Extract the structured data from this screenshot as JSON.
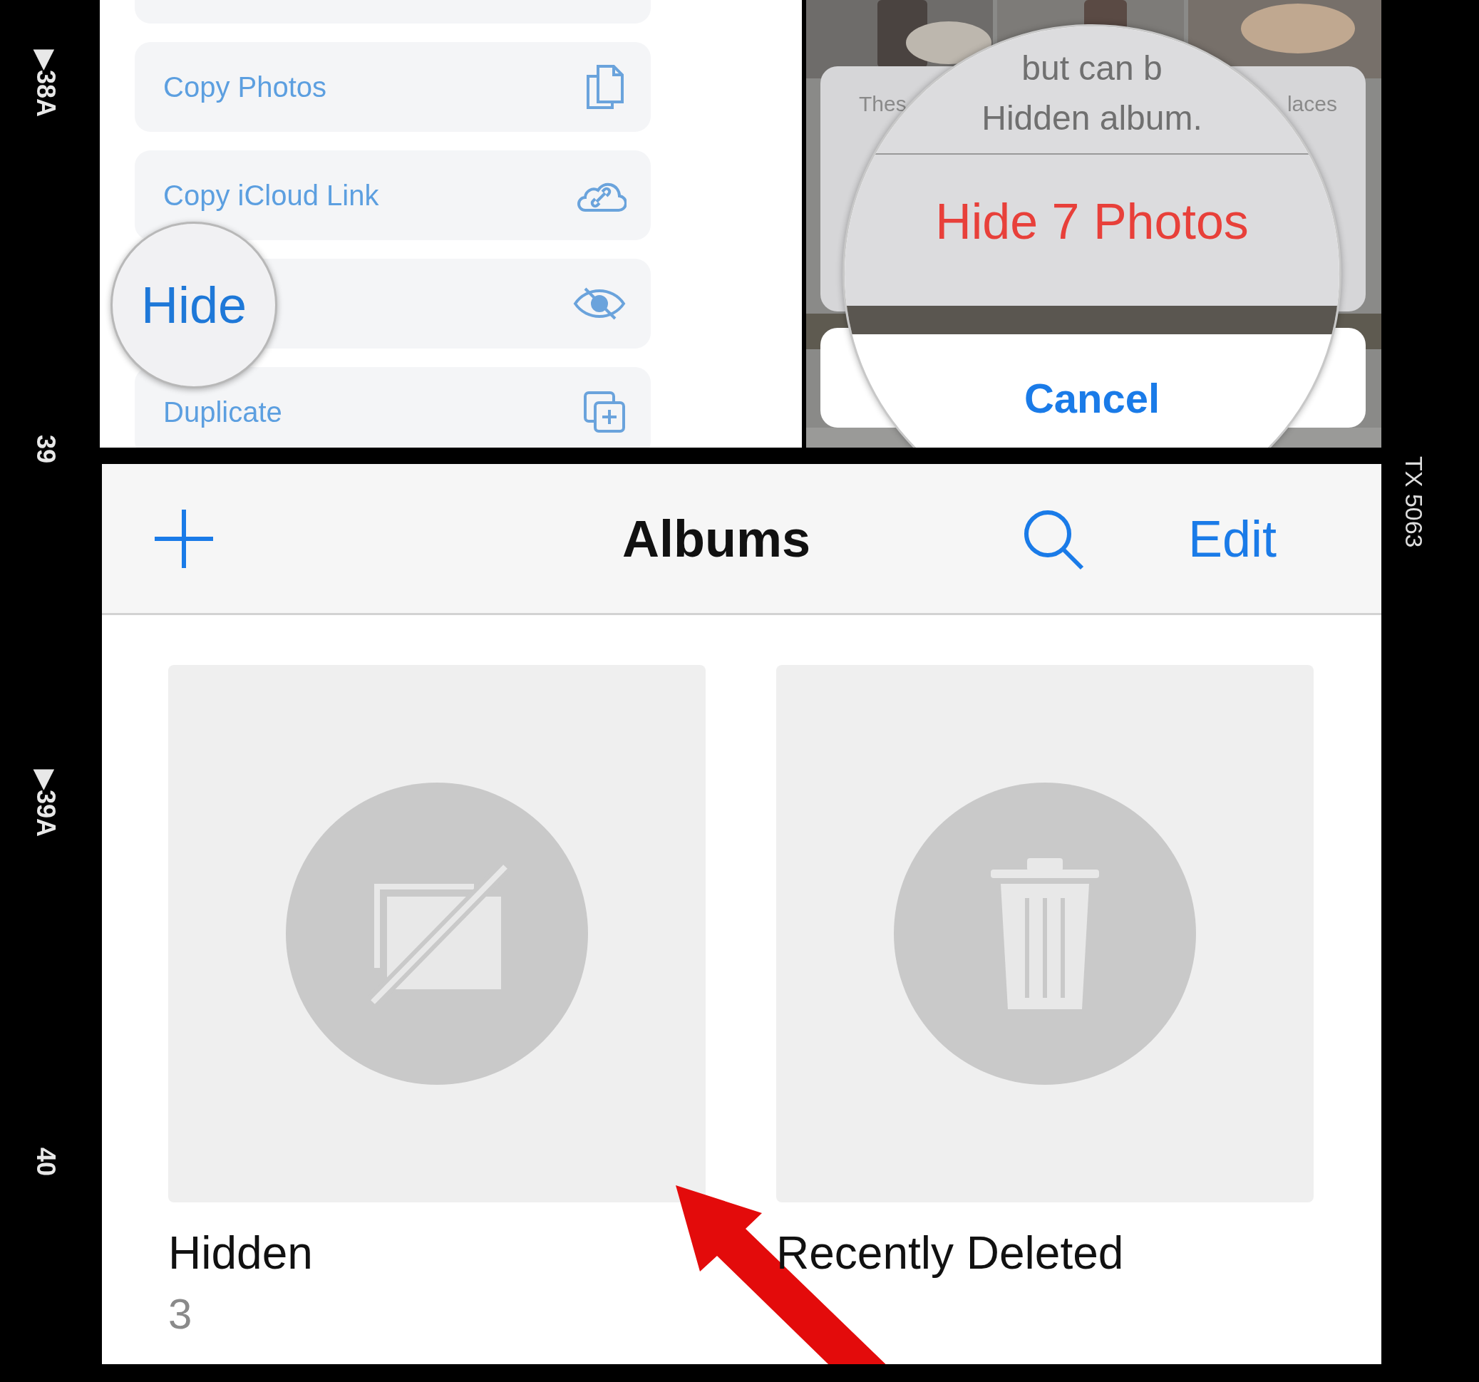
{
  "film_strip": {
    "left_marks": [
      "▶38A",
      "39",
      "▶39A",
      "40"
    ],
    "right_marks": [
      "TX 5063"
    ]
  },
  "share_menu": {
    "items": [
      {
        "kind": "copy",
        "label": "Copy Photos",
        "magnified": false
      },
      {
        "kind": "link",
        "label": "Copy iCloud Link",
        "magnified": false
      },
      {
        "kind": "hide",
        "label": "Hide",
        "magnified": true
      },
      {
        "kind": "duplicate",
        "label": "Duplicate",
        "magnified": false
      }
    ]
  },
  "confirm_sheet": {
    "message_left": "Thes",
    "message_right": "laces",
    "magnified_lines": [
      "but can b",
      "Hidden album."
    ],
    "action": "Hide 7 Photos",
    "cancel": "Cancel"
  },
  "albums_screen": {
    "title": "Albums",
    "edit": "Edit",
    "albums": [
      {
        "kind": "hidden",
        "name": "Hidden",
        "count": "3"
      },
      {
        "kind": "deleted",
        "name": "Recently Deleted"
      }
    ]
  }
}
